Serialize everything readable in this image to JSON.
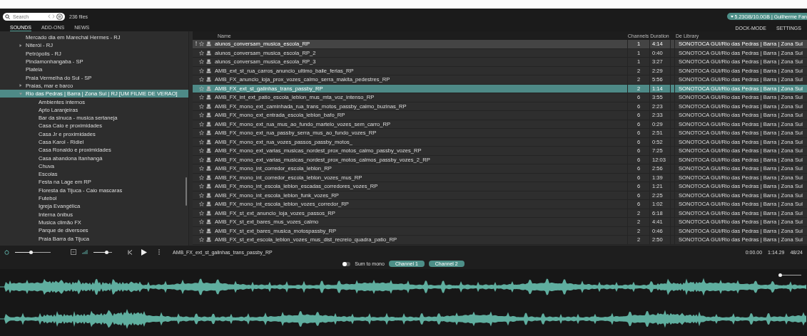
{
  "search": {
    "placeholder": "Search"
  },
  "file_count": "236 files",
  "storage": {
    "label": "5.23GB/10.0GB | Guilherme Fan"
  },
  "tabs": [
    {
      "label": "SOUNDS",
      "selected": true
    },
    {
      "label": "ADD-ONS",
      "selected": false
    },
    {
      "label": "NEWS",
      "selected": false
    }
  ],
  "right_links": [
    "DOCK-MODE",
    "SETTINGS"
  ],
  "sidebar": {
    "items": [
      {
        "label": "Mercado dia em Marechal Hermes - RJ"
      },
      {
        "label": "Niterói - RJ",
        "expanded": false,
        "selected": false
      },
      {
        "label": "Petrópolis - RJ"
      },
      {
        "label": "Pindamonhangaba - SP"
      },
      {
        "label": "Plateia"
      },
      {
        "label": "Praia Vermelha do Sul - SP"
      },
      {
        "label": "Praias, mar e barco",
        "expanded": false,
        "selected": false
      },
      {
        "label": "Rio das Pedras | Barra | Zona Sul | RJ [UM FILME DE VERAO]",
        "expanded": true,
        "selected": true,
        "children": [
          {
            "label": "Ambientes internos"
          },
          {
            "label": "Apto Laranjeiras"
          },
          {
            "label": "Bar da sinuca - musica sertaneja"
          },
          {
            "label": "Casa Caio e proximidades"
          },
          {
            "label": "Casa Jr e proximidades"
          },
          {
            "label": "Casa Karol - Ridiel"
          },
          {
            "label": "Casa Ronaldo e proximidades"
          },
          {
            "label": "Casa abandona Itanhangá"
          },
          {
            "label": "Chuva"
          },
          {
            "label": "Escolas"
          },
          {
            "label": "Festa na Lage em RP"
          },
          {
            "label": "Floresta da Tijuca - Caio mascaras"
          },
          {
            "label": "Futebol"
          },
          {
            "label": "Igreja Evangélica"
          },
          {
            "label": "Interna ônibus"
          },
          {
            "label": "Musica climão FX"
          },
          {
            "label": "Parque de diversoes"
          },
          {
            "label": "Praia Barra da Tijuca"
          }
        ]
      }
    ]
  },
  "table": {
    "columns": [
      "Name",
      "Channels",
      "Duration",
      "De Library"
    ],
    "rows": [
      {
        "name": "alunos_conversam_musica_escola_RP",
        "channels": "1",
        "duration": "4:14",
        "library": "SONOTOCA GUI/Rio das Pedras | Barra | Zona Sul",
        "selected": false,
        "playing": true
      },
      {
        "name": "alunos_conversam_musica_escola_RP_2",
        "channels": "1",
        "duration": "0:40",
        "library": "SONOTOCA GUI/Rio das Pedras | Barra | Zona Sul",
        "selected": false,
        "playing": false
      },
      {
        "name": "alunos_conversam_musica_escola_RP_3",
        "channels": "1",
        "duration": "3:27",
        "library": "SONOTOCA GUI/Rio das Pedras | Barra | Zona Sul",
        "selected": false,
        "playing": false
      },
      {
        "name": "AMB_ext_st_rua_carros_anuncio_ultimo_baile_ferias_RP",
        "channels": "2",
        "duration": "2:29",
        "library": "SONOTOCA GUI/Rio das Pedras | Barra | Zona Sul",
        "selected": false,
        "playing": false
      },
      {
        "name": "AMB_FX_anuncio_loja_prox_vozes_calmo_serra_makita_pedestres_RP",
        "channels": "2",
        "duration": "5:56",
        "library": "SONOTOCA GUI/Rio das Pedras | Barra | Zona Sul",
        "selected": false,
        "playing": false
      },
      {
        "name": "AMB_FX_ext_st_galinhas_trans_passby_RP",
        "channels": "2",
        "duration": "1:14",
        "library": "SONOTOCA GUI/Rio das Pedras | Barra | Zona Sul",
        "selected": true,
        "playing": false
      },
      {
        "name": "AMB_FX_int_ext_patio_escola_leblon_mus_mta_voz_intenso_RP",
        "channels": "6",
        "duration": "3:55",
        "library": "SONOTOCA GUI/Rio das Pedras | Barra | Zona Sul",
        "selected": false,
        "playing": false
      },
      {
        "name": "AMB_FX_mono_ext_caminhada_rua_trans_motos_passby_calmo_buzinas_RP",
        "channels": "6",
        "duration": "2:23",
        "library": "SONOTOCA GUI/Rio das Pedras | Barra | Zona Sul",
        "selected": false,
        "playing": false
      },
      {
        "name": "AMB_FX_mono_ext_entrada_escola_leblon_bafo_RP",
        "channels": "6",
        "duration": "2:33",
        "library": "SONOTOCA GUI/Rio das Pedras | Barra | Zona Sul",
        "selected": false,
        "playing": false
      },
      {
        "name": "AMB_FX_mono_ext_rua_mus_ao_fundo_martelo_vozes_sem_carro_RP",
        "channels": "6",
        "duration": "0:29",
        "library": "SONOTOCA GUI/Rio das Pedras | Barra | Zona Sul",
        "selected": false,
        "playing": false
      },
      {
        "name": "AMB_FX_mono_ext_rua_passby_serra_mus_ao_fundo_vozes_RP",
        "channels": "6",
        "duration": "2:51",
        "library": "SONOTOCA GUI/Rio das Pedras | Barra | Zona Sul",
        "selected": false,
        "playing": false
      },
      {
        "name": "AMB_FX_mono_ext_rua_vozes_passos_passby_motos_",
        "channels": "6",
        "duration": "0:52",
        "library": "SONOTOCA GUI/Rio das Pedras | Barra | Zona Sul",
        "selected": false,
        "playing": false
      },
      {
        "name": "AMB_FX_mono_ext_varias_musicas_nordest_prox_motos_calmo_passby_vozes_RP",
        "channels": "6",
        "duration": "7:25",
        "library": "SONOTOCA GUI/Rio das Pedras | Barra | Zona Sul",
        "selected": false,
        "playing": false
      },
      {
        "name": "AMB_FX_mono_ext_varias_musicas_nordest_prox_motos_calmos_passby_vozes_2_RP",
        "channels": "6",
        "duration": "12:03",
        "library": "SONOTOCA GUI/Rio das Pedras | Barra | Zona Sul",
        "selected": false,
        "playing": false
      },
      {
        "name": "AMB_FX_mono_int_corredor_escola_leblon_RP",
        "channels": "6",
        "duration": "2:56",
        "library": "SONOTOCA GUI/Rio das Pedras | Barra | Zona Sul",
        "selected": false,
        "playing": false
      },
      {
        "name": "AMB_FX_mono_int_corredor_escola_leblon_vozes_mus_RP",
        "channels": "6",
        "duration": "1:39",
        "library": "SONOTOCA GUI/Rio das Pedras | Barra | Zona Sul",
        "selected": false,
        "playing": false
      },
      {
        "name": "AMB_FX_mono_int_escola_leblon_escadas_corredores_vozes_RP",
        "channels": "6",
        "duration": "1:21",
        "library": "SONOTOCA GUI/Rio das Pedras | Barra | Zona Sul",
        "selected": false,
        "playing": false
      },
      {
        "name": "AMB_FX_mono_int_escola_leblon_funk_vozes_RP",
        "channels": "6",
        "duration": "2:25",
        "library": "SONOTOCA GUI/Rio das Pedras | Barra | Zona Sul",
        "selected": false,
        "playing": false
      },
      {
        "name": "AMB_FX_mono_int_escola_leblon_vozes_corredor_RP",
        "channels": "6",
        "duration": "1:02",
        "library": "SONOTOCA GUI/Rio das Pedras | Barra | Zona Sul",
        "selected": false,
        "playing": false
      },
      {
        "name": "AMB_FX_st_ext_anuncio_loja_vozes_passos_RP",
        "channels": "2",
        "duration": "6:18",
        "library": "SONOTOCA GUI/Rio das Pedras | Barra | Zona Sul",
        "selected": false,
        "playing": false
      },
      {
        "name": "AMB_FX_st_ext_bares_mus_vozes_calmo",
        "channels": "2",
        "duration": "4:41",
        "library": "SONOTOCA GUI/Rio das Pedras | Barra | Zona Sul",
        "selected": false,
        "playing": false
      },
      {
        "name": "AMB_FX_st_ext_bares_musica_motospassby_RP",
        "channels": "2",
        "duration": "0:46",
        "library": "SONOTOCA GUI/Rio das Pedras | Barra | Zona Sul",
        "selected": false,
        "playing": false
      },
      {
        "name": "AMB_FX_st_ext_escola_leblon_vozes_mus_dist_recreio_quadra_patio_RP",
        "channels": "2",
        "duration": "2:50",
        "library": "SONOTOCA GUI/Rio das Pedras | Barra | Zona Sul",
        "selected": false,
        "playing": false
      }
    ]
  },
  "player": {
    "position": {
      "level": 0.45
    },
    "volume": {
      "level": 0.7
    },
    "file": "AMB_FX_ext_st_galinhas_trans_passby_RP",
    "times": [
      "0:00.00",
      "1:14.29",
      "48/24"
    ]
  },
  "channels_bar": {
    "sum_to_mono": {
      "label": "Sum to mono",
      "on": false
    },
    "channels": [
      {
        "label": "Channel 1",
        "selected": true
      },
      {
        "label": "Channel 2",
        "selected": true
      }
    ]
  },
  "waveform": {
    "zoom": {
      "level": 0
    }
  }
}
